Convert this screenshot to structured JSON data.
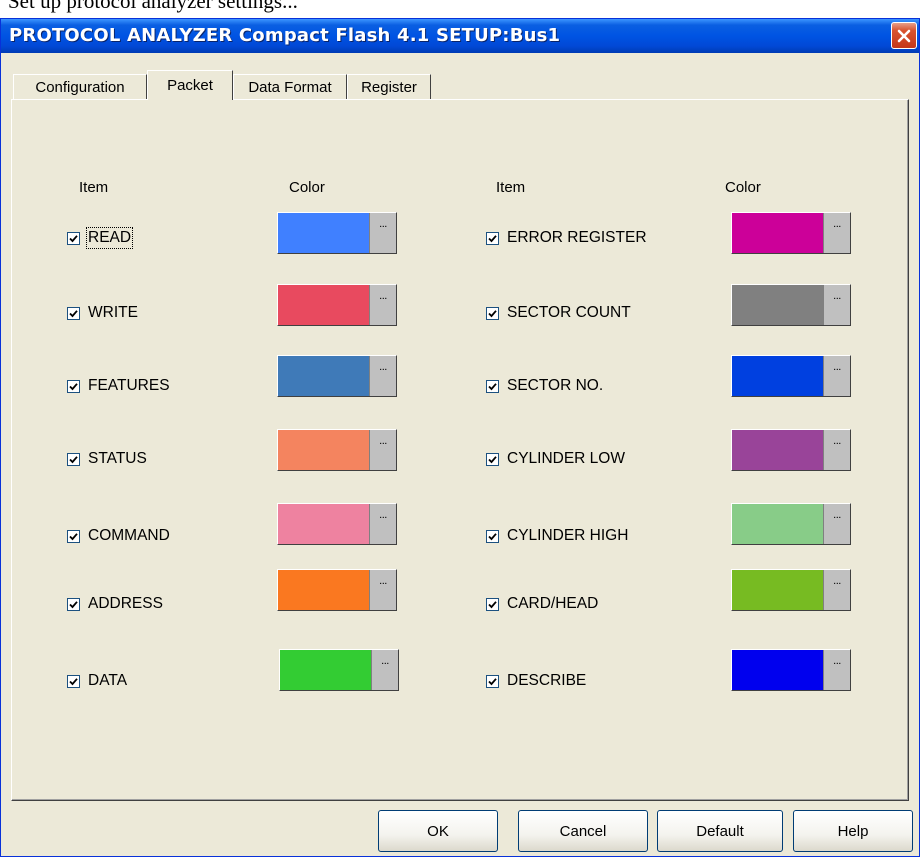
{
  "page_caption": "Set up protocol analyzer settings...",
  "window": {
    "title": "PROTOCOL ANALYZER Compact Flash 4.1 SETUP:Bus1"
  },
  "tabs": [
    {
      "label": "Configuration",
      "active": false
    },
    {
      "label": "Packet",
      "active": true
    },
    {
      "label": "Data Format",
      "active": false
    },
    {
      "label": "Register",
      "active": false
    }
  ],
  "headers": {
    "item": "Item",
    "color": "Color"
  },
  "left_items": [
    {
      "label": "READ",
      "checked": true,
      "color": "#4080ff",
      "focused": true
    },
    {
      "label": "WRITE",
      "checked": true,
      "color": "#e84a5f"
    },
    {
      "label": "FEATURES",
      "checked": true,
      "color": "#3f7ab8"
    },
    {
      "label": "STATUS",
      "checked": true,
      "color": "#f4845f"
    },
    {
      "label": "COMMAND",
      "checked": true,
      "color": "#ee82a0"
    },
    {
      "label": "ADDRESS",
      "checked": true,
      "color": "#fa7820"
    },
    {
      "label": "DATA",
      "checked": true,
      "color": "#33cc33"
    }
  ],
  "right_items": [
    {
      "label": "ERROR REGISTER",
      "checked": true,
      "color": "#cc0099"
    },
    {
      "label": "SECTOR COUNT",
      "checked": true,
      "color": "#808080"
    },
    {
      "label": "SECTOR NO.",
      "checked": true,
      "color": "#0040e0"
    },
    {
      "label": "CYLINDER LOW",
      "checked": true,
      "color": "#994499"
    },
    {
      "label": "CYLINDER HIGH",
      "checked": true,
      "color": "#88cc88"
    },
    {
      "label": "CARD/HEAD",
      "checked": true,
      "color": "#77bb22"
    },
    {
      "label": "DESCRIBE",
      "checked": true,
      "color": "#0000ee"
    }
  ],
  "browse_label": "...",
  "buttons": {
    "ok": "OK",
    "cancel": "Cancel",
    "default": "Default",
    "help": "Help"
  }
}
